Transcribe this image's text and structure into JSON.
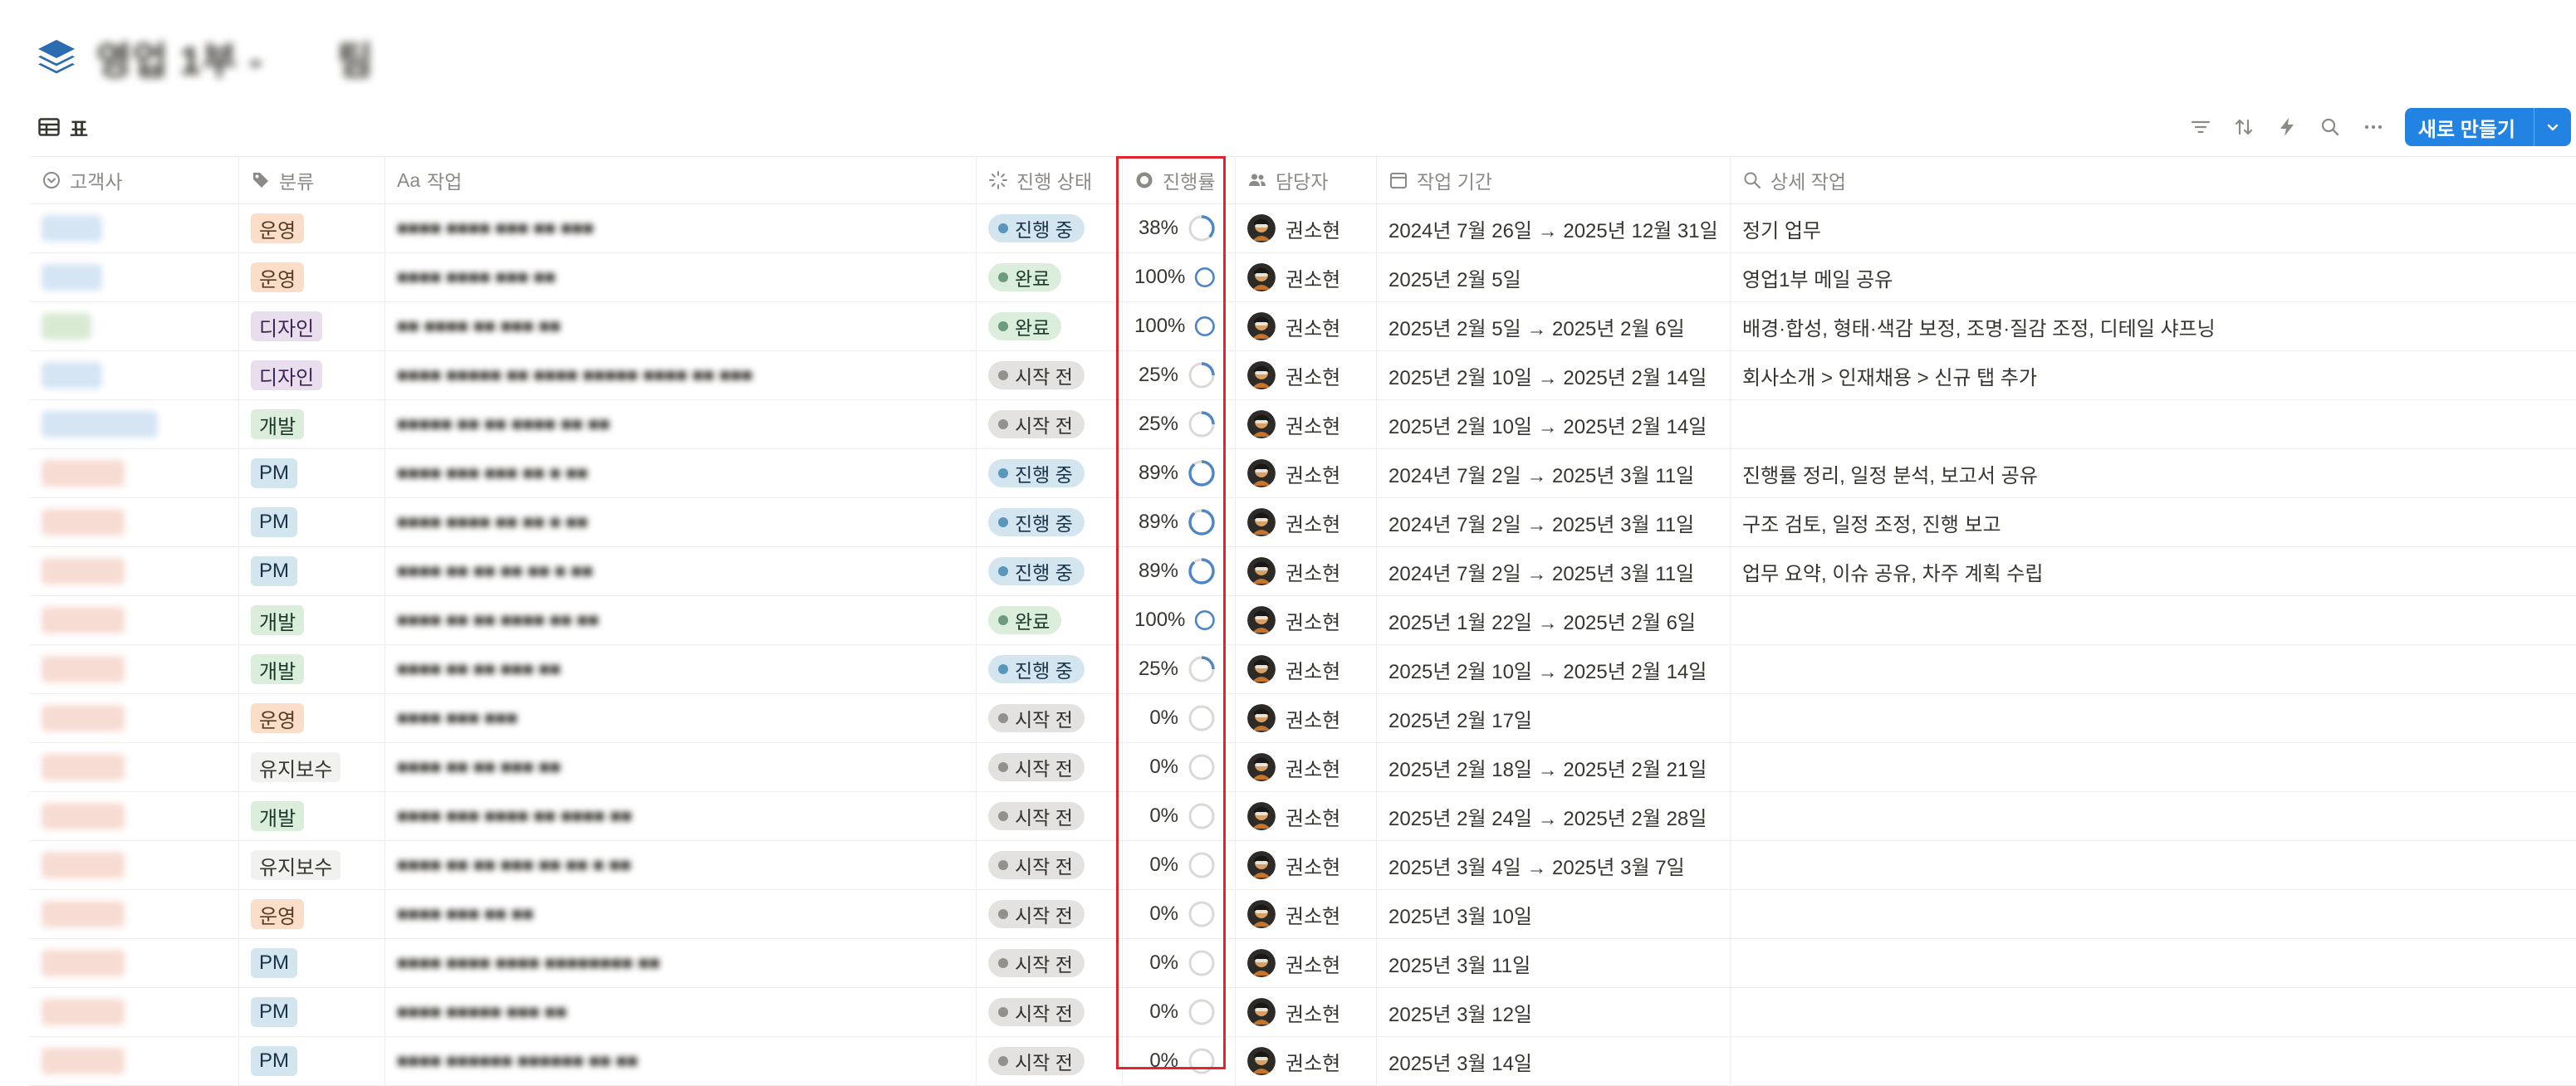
{
  "header": {
    "title": "영업 1부 -",
    "title_tail": "팀",
    "icon": "stack-icon"
  },
  "view": {
    "tab_label": "표",
    "tab_icon": "table-icon"
  },
  "toolbar": {
    "icons": [
      "filter-icon",
      "sort-icon",
      "automation-icon",
      "search-icon",
      "more-icon"
    ],
    "new_label": "새로 만들기"
  },
  "columns": {
    "client": "고객사",
    "category": "분류",
    "task": "작업",
    "task_prefix": "Aa",
    "status": "진행 상태",
    "progress": "진행률",
    "owner": "담당자",
    "period": "작업 기간",
    "detail": "상세 작업"
  },
  "colors": {
    "accent": "#2383e2",
    "highlight": "#e5232c",
    "ring_fill": "#4d86c8",
    "ring_track": "#d9d9d6"
  },
  "rows": [
    {
      "client": "■■■■",
      "client_color": "#d5e5f4",
      "category": "운영",
      "task": "■■■■ ■■■■ ■■■ ■■ ■■■",
      "status": "진행 중",
      "progress": 38,
      "progress_label": "38%",
      "owner": "권소현",
      "period": "2024년 7월 26일 → 2025년 12월 31일",
      "detail": "정기 업무"
    },
    {
      "client": "■■■■",
      "client_color": "#d5e5f4",
      "category": "운영",
      "task": "■■■■ ■■■■ ■■■ ■■",
      "status": "완료",
      "progress": 100,
      "progress_label": "100%",
      "owner": "권소현",
      "period": "2025년 2월 5일",
      "detail": "영업1부 메일 공유"
    },
    {
      "client": "■■■",
      "client_color": "#d9ead3",
      "category": "디자인",
      "task": "■■ ■■■■ ■■ ■■■ ■■",
      "status": "완료",
      "progress": 100,
      "progress_label": "100%",
      "owner": "권소현",
      "period": "2025년 2월 5일 → 2025년 2월 6일",
      "detail": "배경·합성, 형태·색감 보정, 조명·질감 조정, 디테일 샤프닝"
    },
    {
      "client": "■■■■",
      "client_color": "#d5e5f4",
      "category": "디자인",
      "task": "■■■■ ■■■■■ ■■ ■■■■ ■■■■■ ■■■■ ■■ ■■■",
      "status": "시작 전",
      "progress": 25,
      "progress_label": "25%",
      "owner": "권소현",
      "period": "2025년 2월 10일 → 2025년 2월 14일",
      "detail": "회사소개 > 인재채용 > 신규 탭 추가"
    },
    {
      "client": "■■■■■■■■■",
      "client_color": "#d5e5f4",
      "category": "개발",
      "task": "■■■■■ ■■ ■■ ■■■■ ■■ ■■",
      "status": "시작 전",
      "progress": 25,
      "progress_label": "25%",
      "owner": "권소현",
      "period": "2025년 2월 10일 → 2025년 2월 14일",
      "detail": ""
    },
    {
      "client": "■■■■■■",
      "client_color": "#f7dcd3",
      "category": "PM",
      "task": "■■■■ ■■■ ■■■ ■■ ■ ■■",
      "status": "진행 중",
      "progress": 89,
      "progress_label": "89%",
      "owner": "권소현",
      "period": "2024년 7월 2일 → 2025년 3월 11일",
      "detail": "진행률 정리, 일정 분석, 보고서 공유"
    },
    {
      "client": "■■■■■■",
      "client_color": "#f7dcd3",
      "category": "PM",
      "task": "■■■■ ■■■■ ■■ ■■ ■ ■■",
      "status": "진행 중",
      "progress": 89,
      "progress_label": "89%",
      "owner": "권소현",
      "period": "2024년 7월 2일 → 2025년 3월 11일",
      "detail": "구조 검토, 일정 조정, 진행 보고"
    },
    {
      "client": "■■■■■■",
      "client_color": "#f7dcd3",
      "category": "PM",
      "task": "■■■■ ■■ ■■ ■■ ■■ ■ ■■",
      "status": "진행 중",
      "progress": 89,
      "progress_label": "89%",
      "owner": "권소현",
      "period": "2024년 7월 2일 → 2025년 3월 11일",
      "detail": "업무 요약, 이슈 공유, 차주 계획 수립"
    },
    {
      "client": "■■■■■■",
      "client_color": "#f7dcd3",
      "category": "개발",
      "task": "■■■■ ■■ ■■ ■■■■ ■■ ■■",
      "status": "완료",
      "progress": 100,
      "progress_label": "100%",
      "owner": "권소현",
      "period": "2025년 1월 22일 → 2025년 2월 6일",
      "detail": ""
    },
    {
      "client": "■■■■■■",
      "client_color": "#f7dcd3",
      "category": "개발",
      "task": "■■■■ ■■ ■■ ■■■ ■■",
      "status": "진행 중",
      "progress": 25,
      "progress_label": "25%",
      "owner": "권소현",
      "period": "2025년 2월 10일 → 2025년 2월 14일",
      "detail": ""
    },
    {
      "client": "■■■■■■",
      "client_color": "#f7dcd3",
      "category": "운영",
      "task": "■■■■ ■■■ ■■■",
      "status": "시작 전",
      "progress": 0,
      "progress_label": "0%",
      "owner": "권소현",
      "period": "2025년 2월 17일",
      "detail": ""
    },
    {
      "client": "■■■■■■",
      "client_color": "#f7dcd3",
      "category": "유지보수",
      "task": "■■■■ ■■ ■■ ■■■ ■■",
      "status": "시작 전",
      "progress": 0,
      "progress_label": "0%",
      "owner": "권소현",
      "period": "2025년 2월 18일 → 2025년 2월 21일",
      "detail": ""
    },
    {
      "client": "■■■■■■",
      "client_color": "#f7dcd3",
      "category": "개발",
      "task": "■■■■ ■■■ ■■■■ ■■ ■■■■ ■■",
      "status": "시작 전",
      "progress": 0,
      "progress_label": "0%",
      "owner": "권소현",
      "period": "2025년 2월 24일 → 2025년 2월 28일",
      "detail": ""
    },
    {
      "client": "■■■■■■",
      "client_color": "#f7dcd3",
      "category": "유지보수",
      "task": "■■■■ ■■ ■■ ■■■ ■■ ■■ ■ ■■",
      "status": "시작 전",
      "progress": 0,
      "progress_label": "0%",
      "owner": "권소현",
      "period": "2025년 3월 4일 → 2025년 3월 7일",
      "detail": ""
    },
    {
      "client": "■■■■■■",
      "client_color": "#f7dcd3",
      "category": "운영",
      "task": "■■■■ ■■■ ■■ ■■",
      "status": "시작 전",
      "progress": 0,
      "progress_label": "0%",
      "owner": "권소현",
      "period": "2025년 3월 10일",
      "detail": ""
    },
    {
      "client": "■■■■■■",
      "client_color": "#f7dcd3",
      "category": "PM",
      "task": "■■■■ ■■■■ ■■■■ ■■■■■■■■ ■■",
      "status": "시작 전",
      "progress": 0,
      "progress_label": "0%",
      "owner": "권소현",
      "period": "2025년 3월 11일",
      "detail": ""
    },
    {
      "client": "■■■■■■",
      "client_color": "#f7dcd3",
      "category": "PM",
      "task": "■■■■ ■■■■■ ■■■ ■■",
      "status": "시작 전",
      "progress": 0,
      "progress_label": "0%",
      "owner": "권소현",
      "period": "2025년 3월 12일",
      "detail": ""
    },
    {
      "client": "■■■■■■",
      "client_color": "#f7dcd3",
      "category": "PM",
      "task": "■■■■ ■■■■■■ ■■■■■■ ■■ ■■",
      "status": "시작 전",
      "progress": 0,
      "progress_label": "0%",
      "owner": "권소현",
      "period": "2025년 3월 14일",
      "detail": ""
    }
  ]
}
